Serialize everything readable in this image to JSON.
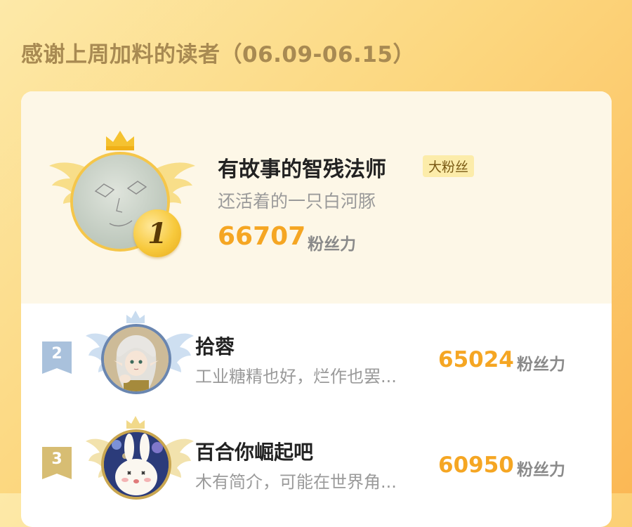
{
  "page": {
    "heading": "感谢上周加料的读者（06.09-06.15）"
  },
  "colors": {
    "accent": "#f5a623",
    "gold": "#f5c64a",
    "silver": "#a9c1dc",
    "bronze": "#d7bd73"
  },
  "top_fan": {
    "rank": "1",
    "name": "有故事的智残法师",
    "badge": "大粉丝",
    "bio": "还活着的一只白河豚",
    "score": "66707",
    "unit": "粉丝力",
    "avatar_icon": "moon-face-avatar-icon",
    "frame_icon": "gold-winged-crown-frame-icon"
  },
  "list": [
    {
      "rank": "2",
      "name": "拾蓉",
      "bio": "工业糖精也好，烂作也罢...",
      "score": "65024",
      "unit": "粉丝力",
      "avatar_icon": "anime-elf-avatar-icon",
      "frame_icon": "silver-winged-crown-frame-icon"
    },
    {
      "rank": "3",
      "name": "百合你崛起吧",
      "bio": "木有简介，可能在世界角...",
      "score": "60950",
      "unit": "粉丝力",
      "avatar_icon": "bunny-avatar-icon",
      "frame_icon": "bronze-winged-crown-frame-icon"
    }
  ]
}
